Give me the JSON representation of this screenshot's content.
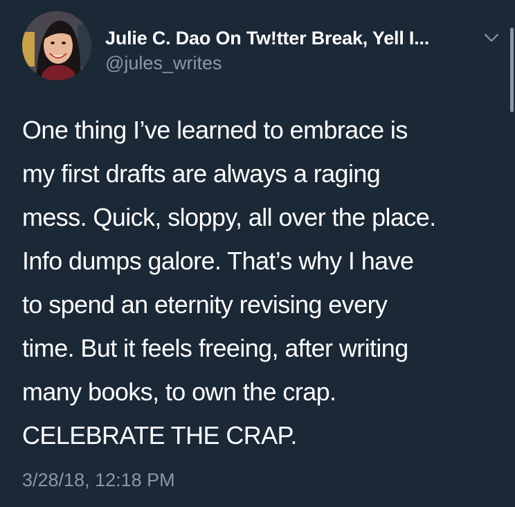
{
  "tweet": {
    "author": {
      "display_name": "Julie C. Dao On Tw!tter Break, Yell I...",
      "handle": "@jules_writes",
      "avatar_icon": "profile-photo"
    },
    "menu_icon": "chevron-down-icon",
    "text_lines": [
      "One thing I’ve learned to embrace is",
      "my first drafts are always a raging",
      "mess. Quick, sloppy, all over the place.",
      "Info dumps galore. That’s why I have",
      "to spend an eternity revising every",
      "time. But it feels freeing, after writing",
      "many books, to own the crap.",
      "CELEBRATE THE CRAP."
    ],
    "timestamp": "3/28/18, 12:18 PM"
  },
  "colors": {
    "background": "#1b2836",
    "primary_text": "#ffffff",
    "secondary_text": "#8899a6"
  }
}
